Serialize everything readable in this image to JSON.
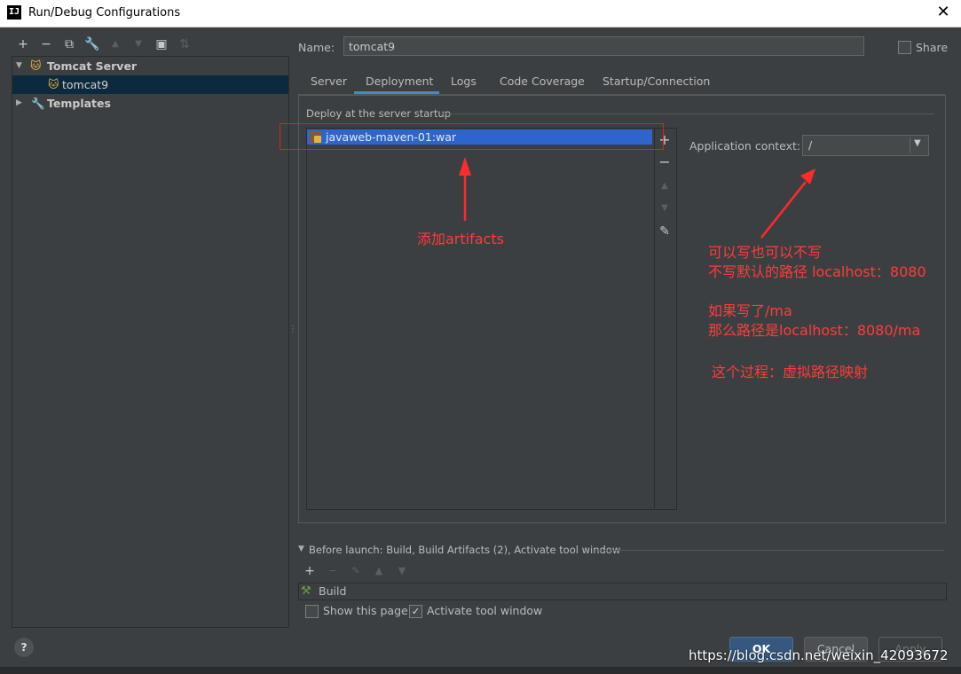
{
  "window": {
    "title": "Run/Debug Configurations",
    "app_icon_text": "IJ",
    "close_glyph": "✕"
  },
  "left_toolbar": {
    "icons": [
      "add-icon",
      "remove-icon",
      "copy-icon",
      "wrench-icon",
      "move-up-icon",
      "move-down-icon",
      "new-folder-icon",
      "sort-icon"
    ]
  },
  "tree": {
    "items": [
      {
        "label": "Tomcat Server",
        "expanded": true
      },
      {
        "label": "tomcat9",
        "selected": true
      },
      {
        "label": "Templates",
        "expanded": false
      }
    ]
  },
  "name_field": {
    "label": "Name:",
    "value": "tomcat9"
  },
  "share": {
    "label": "Share",
    "checked": false
  },
  "tabs": [
    {
      "label": "Server"
    },
    {
      "label": "Deployment",
      "active": true
    },
    {
      "label": "Logs"
    },
    {
      "label": "Code Coverage"
    },
    {
      "label": "Startup/Connection"
    }
  ],
  "deployment": {
    "heading": "Deploy at the server startup",
    "artifacts": [
      "javaweb-maven-01:war"
    ],
    "context_label": "Application context:",
    "context_value": "/"
  },
  "annotations": {
    "add_artifacts": "添加artifacts",
    "lines": [
      "可以写也可以不写",
      "不写默认的路径 localhost：8080",
      "如果写了/ma",
      "那么路径是localhost：8080/ma",
      "这个过程：虚拟路径映射"
    ],
    "color": "#ff3b3b"
  },
  "before_launch": {
    "title": "Before launch: Build, Build Artifacts (2), Activate tool window",
    "tasks": [
      "Build"
    ]
  },
  "options": {
    "show_page": {
      "label": "Show this page",
      "checked": false
    },
    "activate_tool_window": {
      "label": "Activate tool window",
      "checked": true
    }
  },
  "buttons": {
    "ok": "OK",
    "cancel": "Cancel",
    "apply": "Apply",
    "help": "?"
  },
  "watermark": "https://blog.csdn.net/weixin_42093672",
  "colors": {
    "background": "#3c3f41",
    "selection": "#2f65ca",
    "tab_underline": "#4a88c7",
    "ok_button": "#365880"
  }
}
